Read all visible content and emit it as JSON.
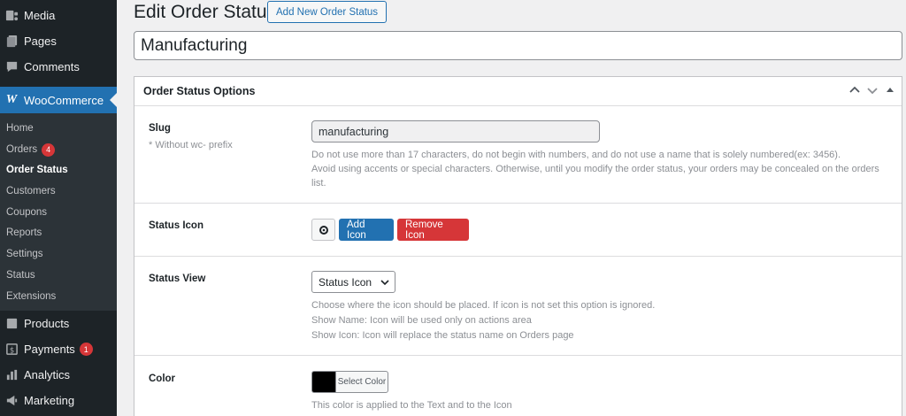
{
  "sidebar": {
    "top_items": [
      {
        "label": "Media",
        "icon": "media-icon"
      },
      {
        "label": "Pages",
        "icon": "pages-icon"
      },
      {
        "label": "Comments",
        "icon": "comments-icon"
      }
    ],
    "woocommerce": {
      "label": "WooCommerce",
      "icon": "woocommerce-icon"
    },
    "submenu": [
      {
        "label": "Home"
      },
      {
        "label": "Orders",
        "badge": "4"
      },
      {
        "label": "Order Status"
      },
      {
        "label": "Customers"
      },
      {
        "label": "Coupons"
      },
      {
        "label": "Reports"
      },
      {
        "label": "Settings"
      },
      {
        "label": "Status"
      },
      {
        "label": "Extensions"
      }
    ],
    "bottom_items": [
      {
        "label": "Products",
        "icon": "products-icon"
      },
      {
        "label": "Payments",
        "icon": "payments-icon",
        "badge": "1"
      },
      {
        "label": "Analytics",
        "icon": "analytics-icon"
      },
      {
        "label": "Marketing",
        "icon": "marketing-icon"
      }
    ]
  },
  "header": {
    "title": "Edit Order Status",
    "add_new_label": "Add New Order Status"
  },
  "title_input": {
    "value": "Manufacturing"
  },
  "panel": {
    "title": "Order Status Options",
    "slug": {
      "label": "Slug",
      "sublabel": "* Without wc- prefix",
      "value": "manufacturing",
      "help1": "Do not use more than 17 characters, do not begin with numbers, and do not use a name that is solely numbered(ex: 3456).",
      "help2": "Avoid using accents or special characters. Otherwise, until you modify the order status, your orders may be concealed on the orders list."
    },
    "status_icon": {
      "label": "Status Icon",
      "add_label": "Add Icon",
      "remove_label": "Remove Icon"
    },
    "status_view": {
      "label": "Status View",
      "selected": "Status Icon",
      "help1": "Choose where the icon should be placed. If icon is not set this option is ignored.",
      "help2": "Show Name: Icon will be used only on actions area",
      "help3": "Show Icon: Icon will replace the status name on Orders page"
    },
    "color": {
      "label": "Color",
      "select_label": "Select Color",
      "value": "#000000",
      "help": "This color is applied to the Text and to the Icon"
    }
  },
  "colors": {
    "sidebar_bg": "#1d2327",
    "accent": "#2271b1",
    "danger": "#d63638"
  }
}
